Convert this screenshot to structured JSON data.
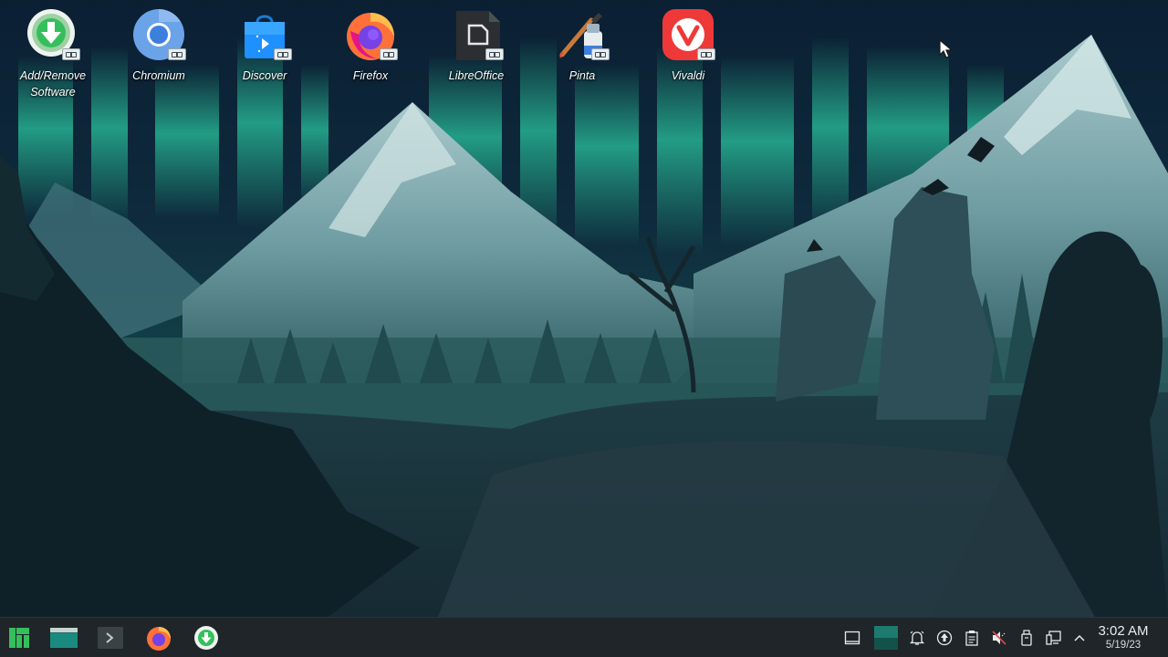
{
  "desktop": {
    "icons": [
      {
        "label": "Add/Remove\nSoftware",
        "icon": "add-remove-software-icon"
      },
      {
        "label": "Chromium",
        "icon": "chromium-icon"
      },
      {
        "label": "Discover",
        "icon": "discover-icon"
      },
      {
        "label": "Firefox",
        "icon": "firefox-icon"
      },
      {
        "label": "LibreOffice",
        "icon": "libreoffice-icon"
      },
      {
        "label": "Pinta",
        "icon": "pinta-icon"
      },
      {
        "label": "Vivaldi",
        "icon": "vivaldi-icon"
      }
    ],
    "wallpaper": "aurora-mountains-forest"
  },
  "taskbar": {
    "launchers": [
      {
        "icon": "manjaro-menu-icon"
      },
      {
        "icon": "file-manager-icon"
      },
      {
        "icon": "terminal-icon"
      },
      {
        "icon": "firefox-icon"
      },
      {
        "icon": "add-remove-software-icon"
      }
    ],
    "tray": [
      {
        "icon": "show-desktop-icon"
      },
      {
        "icon": "pager-icon"
      },
      {
        "icon": "notifications-icon"
      },
      {
        "icon": "updates-icon"
      },
      {
        "icon": "clipboard-icon"
      },
      {
        "icon": "volume-muted-icon"
      },
      {
        "icon": "usb-device-icon"
      },
      {
        "icon": "network-wired-icon"
      },
      {
        "icon": "expand-tray-icon"
      }
    ],
    "clock": {
      "time": "3:02 AM",
      "date": "5/19/23"
    }
  },
  "colors": {
    "aurora": "#2fd6a6",
    "taskbar": "#1f2528",
    "manjaro": "#35bf5c"
  }
}
